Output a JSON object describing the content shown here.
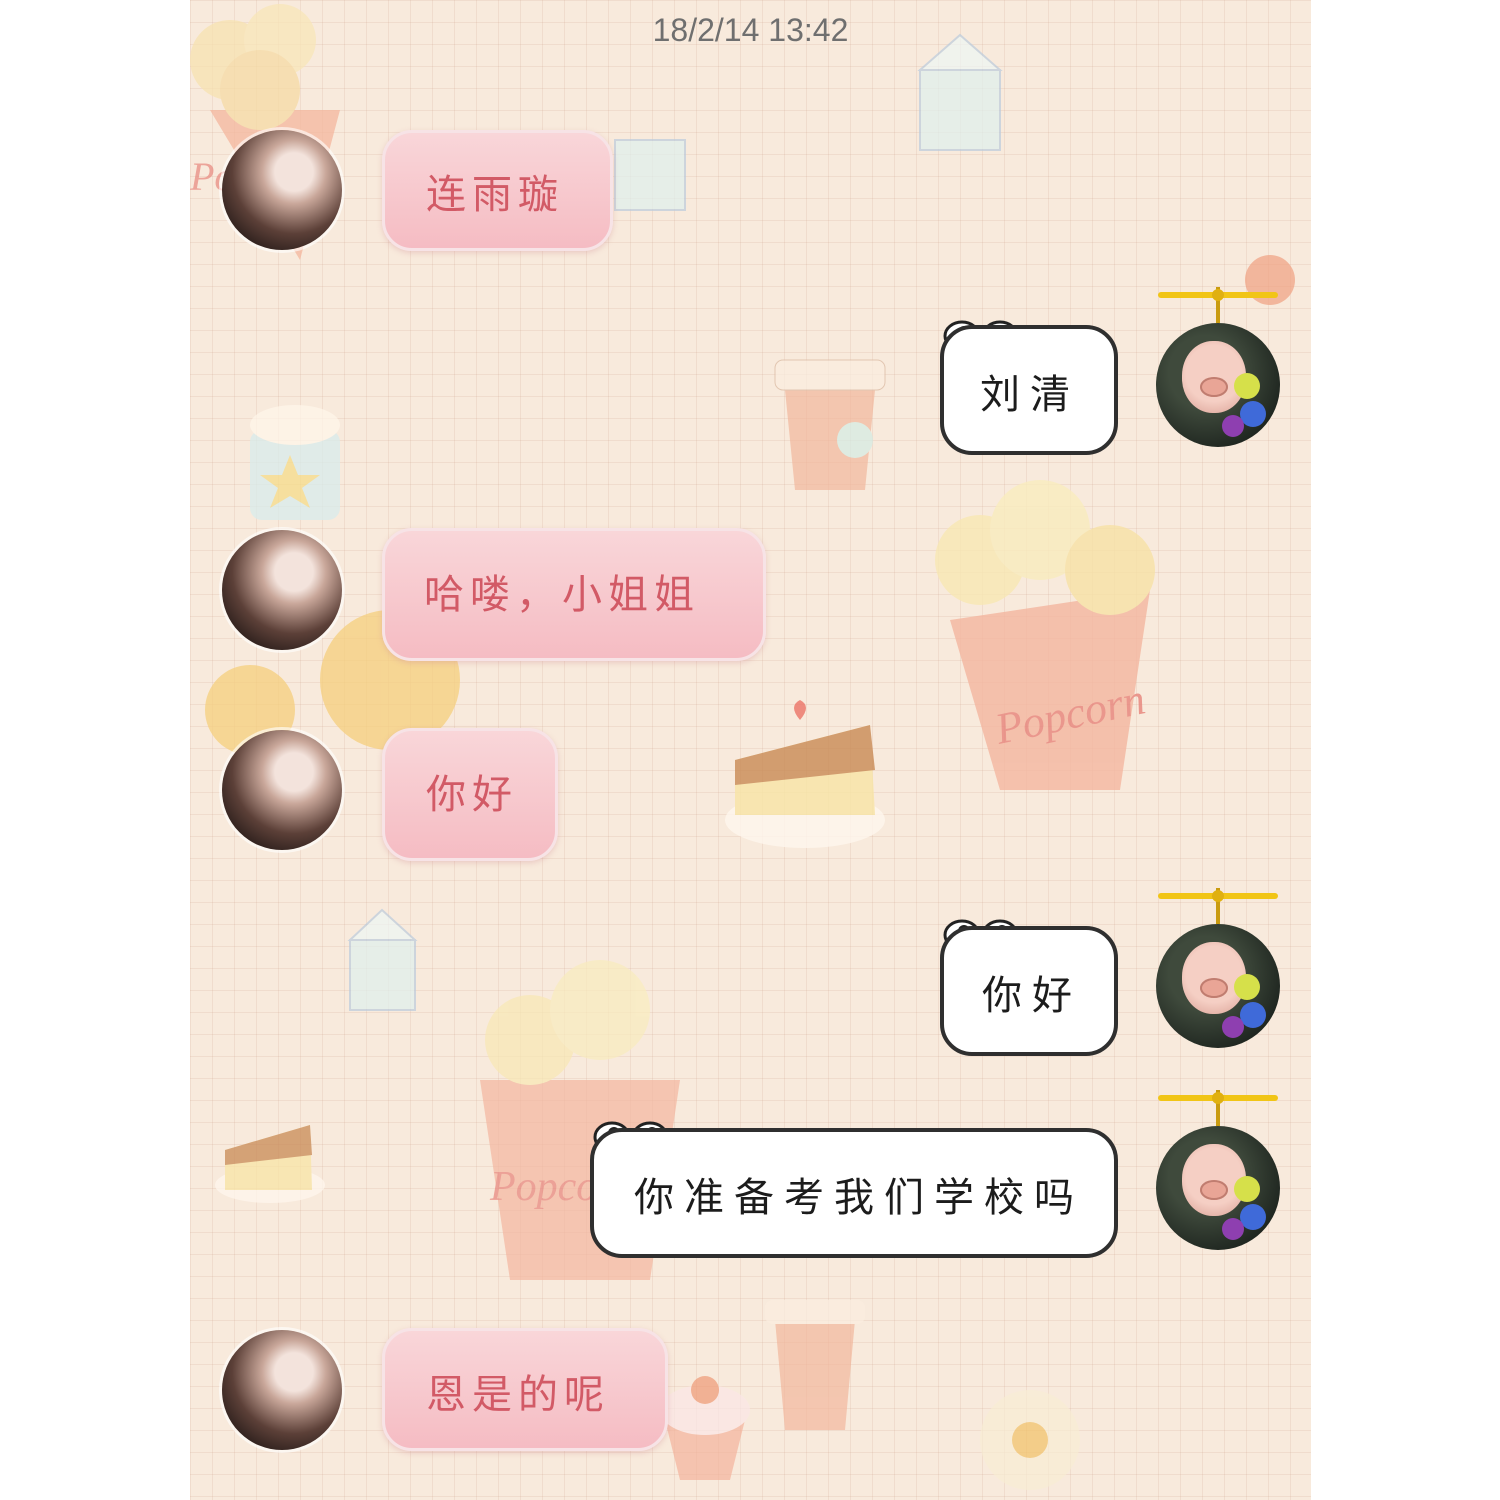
{
  "status": {
    "timestamp": "18/2/14 13:42"
  },
  "theme": {
    "background": "#f8eadc",
    "incoming_text": "#d25a66",
    "outgoing_border": "#2f2f2f"
  },
  "messages": [
    {
      "sender": "other",
      "text": "连雨璇"
    },
    {
      "sender": "me",
      "text": "刘清"
    },
    {
      "sender": "other",
      "text": "哈喽，小姐姐"
    },
    {
      "sender": "other",
      "text": "你好"
    },
    {
      "sender": "me",
      "text": "你好"
    },
    {
      "sender": "me",
      "text": "你准备考我们学校吗"
    },
    {
      "sender": "other",
      "text": "恩是的呢"
    }
  ],
  "background_art": {
    "popcorn_label": "Popcorn"
  }
}
